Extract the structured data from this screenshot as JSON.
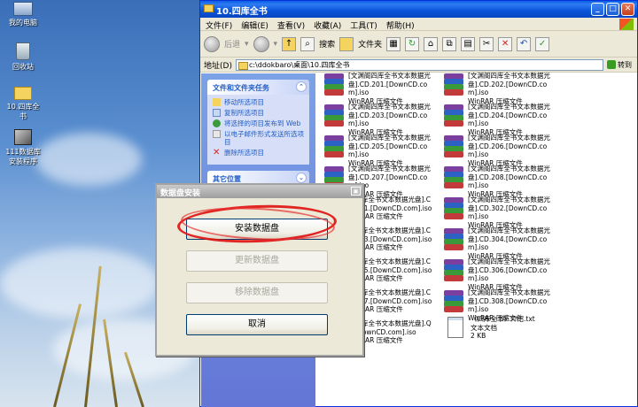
{
  "desktop": {
    "icons": [
      {
        "label": "我的电脑"
      },
      {
        "label": "回收站"
      },
      {
        "label": "10.四库全书"
      },
      {
        "label": "111数据库安装程序"
      }
    ]
  },
  "window": {
    "title": "10.四库全书",
    "menu": [
      "文件(F)",
      "编辑(E)",
      "查看(V)",
      "收藏(A)",
      "工具(T)",
      "帮助(H)"
    ],
    "toolbar": {
      "back": "后退",
      "search": "搜索",
      "folders": "文件夹"
    },
    "address": {
      "label": "地址(D)",
      "value": "c:\\ddokbaro\\桌面\\10.四库全书",
      "go": "转到"
    },
    "taskpane": {
      "file_tasks_title": "文件和文件夹任务",
      "file_tasks": [
        "移动所选项目",
        "复制所选项目",
        "将选择的项目发布到 Web",
        "以电子邮件形式发送所选项目",
        "删除所选项目"
      ],
      "other_places_title": "其它位置"
    },
    "files": [
      {
        "name": "[文渊阁四库全书文本数据光盘].CD.201.[DownCD.com].iso",
        "type": "WinRAR 压缩文件"
      },
      {
        "name": "[文渊阁四库全书文本数据光盘].CD.202.[DownCD.com].iso",
        "type": "WinRAR 压缩文件"
      },
      {
        "name": "[文渊阁四库全书文本数据光盘].CD.203.[DownCD.com].iso",
        "type": "WinRAR 压缩文件"
      },
      {
        "name": "[文渊阁四库全书文本数据光盘].CD.204.[DownCD.com].iso",
        "type": "WinRAR 压缩文件"
      },
      {
        "name": "[文渊阁四库全书文本数据光盘].CD.205.[DownCD.com].iso",
        "type": "WinRAR 压缩文件"
      },
      {
        "name": "[文渊阁四库全书文本数据光盘].CD.206.[DownCD.com].iso",
        "type": "WinRAR 压缩文件"
      },
      {
        "name": "[文渊阁四库全书文本数据光盘].CD.207.[DownCD.com].iso",
        "type": "WinRAR 压缩文件"
      },
      {
        "name": "[文渊阁四库全书文本数据光盘].CD.208.[DownCD.com].iso",
        "type": "WinRAR 压缩文件"
      },
      {
        "name": "阁四库全书文本数据光盘].CD.301.[DownCD.com].iso",
        "type": "WinRAR 压缩文件"
      },
      {
        "name": "[文渊阁四库全书文本数据光盘].CD.302.[DownCD.com].iso",
        "type": "WinRAR 压缩文件"
      },
      {
        "name": "阁四库全书文本数据光盘].CD.303.[DownCD.com].iso",
        "type": "WinRAR 压缩文件"
      },
      {
        "name": "[文渊阁四库全书文本数据光盘].CD.304.[DownCD.com].iso",
        "type": "WinRAR 压缩文件"
      },
      {
        "name": "阁四库全书文本数据光盘].CD.305.[DownCD.com].iso",
        "type": "WinRAR 压缩文件"
      },
      {
        "name": "[文渊阁四库全书文本数据光盘].CD.306.[DownCD.com].iso",
        "type": "WinRAR 压缩文件"
      },
      {
        "name": "阁四库全书文本数据光盘].CD.307.[DownCD.com].iso",
        "type": "WinRAR 压缩文件"
      },
      {
        "name": "[文渊阁四库全书文本数据光盘].CD.308.[DownCD.com].iso",
        "type": "WinRAR 压缩文件"
      },
      {
        "name": "阁四库全书文本数据光盘].QS.[DownCD.com].iso",
        "type": "WinRAR 压缩文件"
      }
    ],
    "textfile": {
      "name": "《四库全书》介绍.txt",
      "type": "文本文档",
      "size": "2 KB"
    }
  },
  "dialog": {
    "title": "数据盘安装",
    "install": "安装数据盘",
    "update": "更新数据盘",
    "remove": "移除数据盘",
    "cancel": "取消"
  },
  "colors": {
    "accent": "#0a54d8",
    "highlight": "#e01010",
    "taskpane": "#6375d6"
  }
}
